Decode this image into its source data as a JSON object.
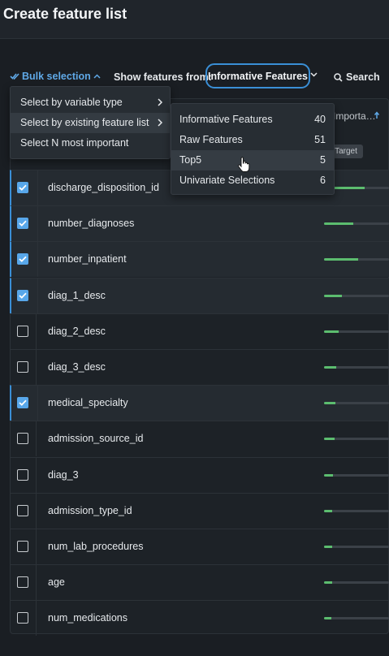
{
  "header": {
    "title": "Create feature list"
  },
  "toolbar": {
    "bulk_label": "Bulk selection",
    "show_label": "Show features from:",
    "selected_source": "Informative Features",
    "search_label": "Search"
  },
  "table": {
    "header_partial": "Importa…",
    "target_badge": "Target",
    "rows": [
      {
        "name": "discharge_disposition_id",
        "checked": true,
        "importance": 0.62
      },
      {
        "name": "number_diagnoses",
        "checked": true,
        "importance": 0.45
      },
      {
        "name": "number_inpatient",
        "checked": true,
        "importance": 0.52
      },
      {
        "name": "diag_1_desc",
        "checked": true,
        "importance": 0.27
      },
      {
        "name": "diag_2_desc",
        "checked": false,
        "importance": 0.22
      },
      {
        "name": "diag_3_desc",
        "checked": false,
        "importance": 0.19
      },
      {
        "name": "medical_specialty",
        "checked": true,
        "importance": 0.18
      },
      {
        "name": "admission_source_id",
        "checked": false,
        "importance": 0.16
      },
      {
        "name": "diag_3",
        "checked": false,
        "importance": 0.14
      },
      {
        "name": "admission_type_id",
        "checked": false,
        "importance": 0.13
      },
      {
        "name": "num_lab_procedures",
        "checked": false,
        "importance": 0.13
      },
      {
        "name": "age",
        "checked": false,
        "importance": 0.12
      },
      {
        "name": "num_medications",
        "checked": false,
        "importance": 0.11
      }
    ]
  },
  "bulk_menu": {
    "items": [
      {
        "label": "Select by variable type",
        "has_submenu": true
      },
      {
        "label": "Select by existing feature list",
        "has_submenu": true
      },
      {
        "label": "Select N most important",
        "has_submenu": false
      }
    ]
  },
  "feature_list_submenu": {
    "items": [
      {
        "label": "Informative Features",
        "count": "40"
      },
      {
        "label": "Raw Features",
        "count": "51"
      },
      {
        "label": "Top5",
        "count": "5"
      },
      {
        "label": "Univariate Selections",
        "count": "6"
      }
    ]
  },
  "colors": {
    "accent": "#3a8fd6",
    "bar": "#5cbd6f",
    "background": "#1a1e23"
  }
}
